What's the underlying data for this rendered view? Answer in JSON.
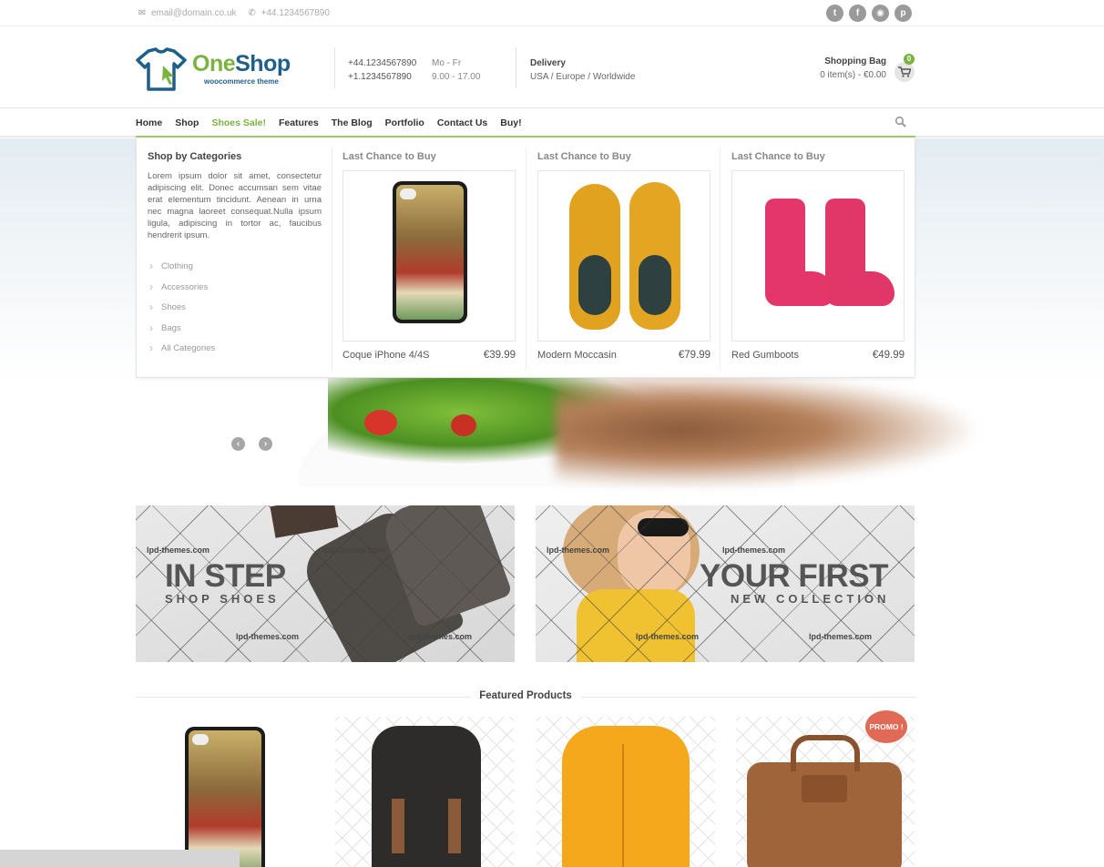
{
  "topbar": {
    "email": "email@domain.co.uk",
    "phone": "+44.1234567890",
    "social": [
      "twitter-icon",
      "facebook-icon",
      "rss-icon",
      "pinterest-icon"
    ]
  },
  "header": {
    "brand_a": "One",
    "brand_b": "Shop",
    "tagline": "woocommerce theme",
    "phone1": "+44.1234567890",
    "phone2": "+1.1234567890",
    "days": "Mo - Fr",
    "hours": "9.00 - 17.00",
    "delivery_title": "Delivery",
    "delivery_regions": "USA / Europe / Worldwide",
    "bag_title": "Shopping Bag",
    "bag_summary": "0 item(s) - €0.00",
    "bag_count": "0"
  },
  "nav": {
    "items": [
      "Home",
      "Shop",
      "Shoes Sale!",
      "Features",
      "The Blog",
      "Portfolio",
      "Contact Us",
      "Buy!"
    ],
    "active": "Shoes Sale!"
  },
  "mega_menu": {
    "categories_title": "Shop by Categories",
    "description": "Lorem ipsum dolor sit amet, consectetur adipiscing elit. Donec accumsan sem vitae erat elementum tincidunt. Aenean in urna nec magna laoreet consequat.Nulla ipsum ligula, adipiscing in tortor ac, faucibus hendrerit ipsum.",
    "categories": [
      "Clothing",
      "Accessories",
      "Shoes",
      "Bags",
      "All Categories"
    ],
    "products": [
      {
        "heading": "Last Chance to Buy",
        "name": "Coque iPhone 4/4S",
        "price": "€39.99"
      },
      {
        "heading": "Last Chance to Buy",
        "name": "Modern Moccasin",
        "price": "€79.99"
      },
      {
        "heading": "Last Chance to Buy",
        "name": "Red Gumboots",
        "price": "€49.99"
      }
    ]
  },
  "banners": [
    {
      "title": "IN STEP",
      "subtitle": "SHOP SHOES",
      "watermark": "lpd-themes.com"
    },
    {
      "title": "YOUR FIRST",
      "subtitle": "NEW COLLECTION",
      "watermark": "lpd-themes.com"
    }
  ],
  "featured": {
    "title": "Featured Products",
    "promo_badge": "PROMO !"
  },
  "colors": {
    "accent_green": "#7ab33f",
    "brand_blue": "#1f5f8b",
    "promo_red": "#e06a55"
  }
}
